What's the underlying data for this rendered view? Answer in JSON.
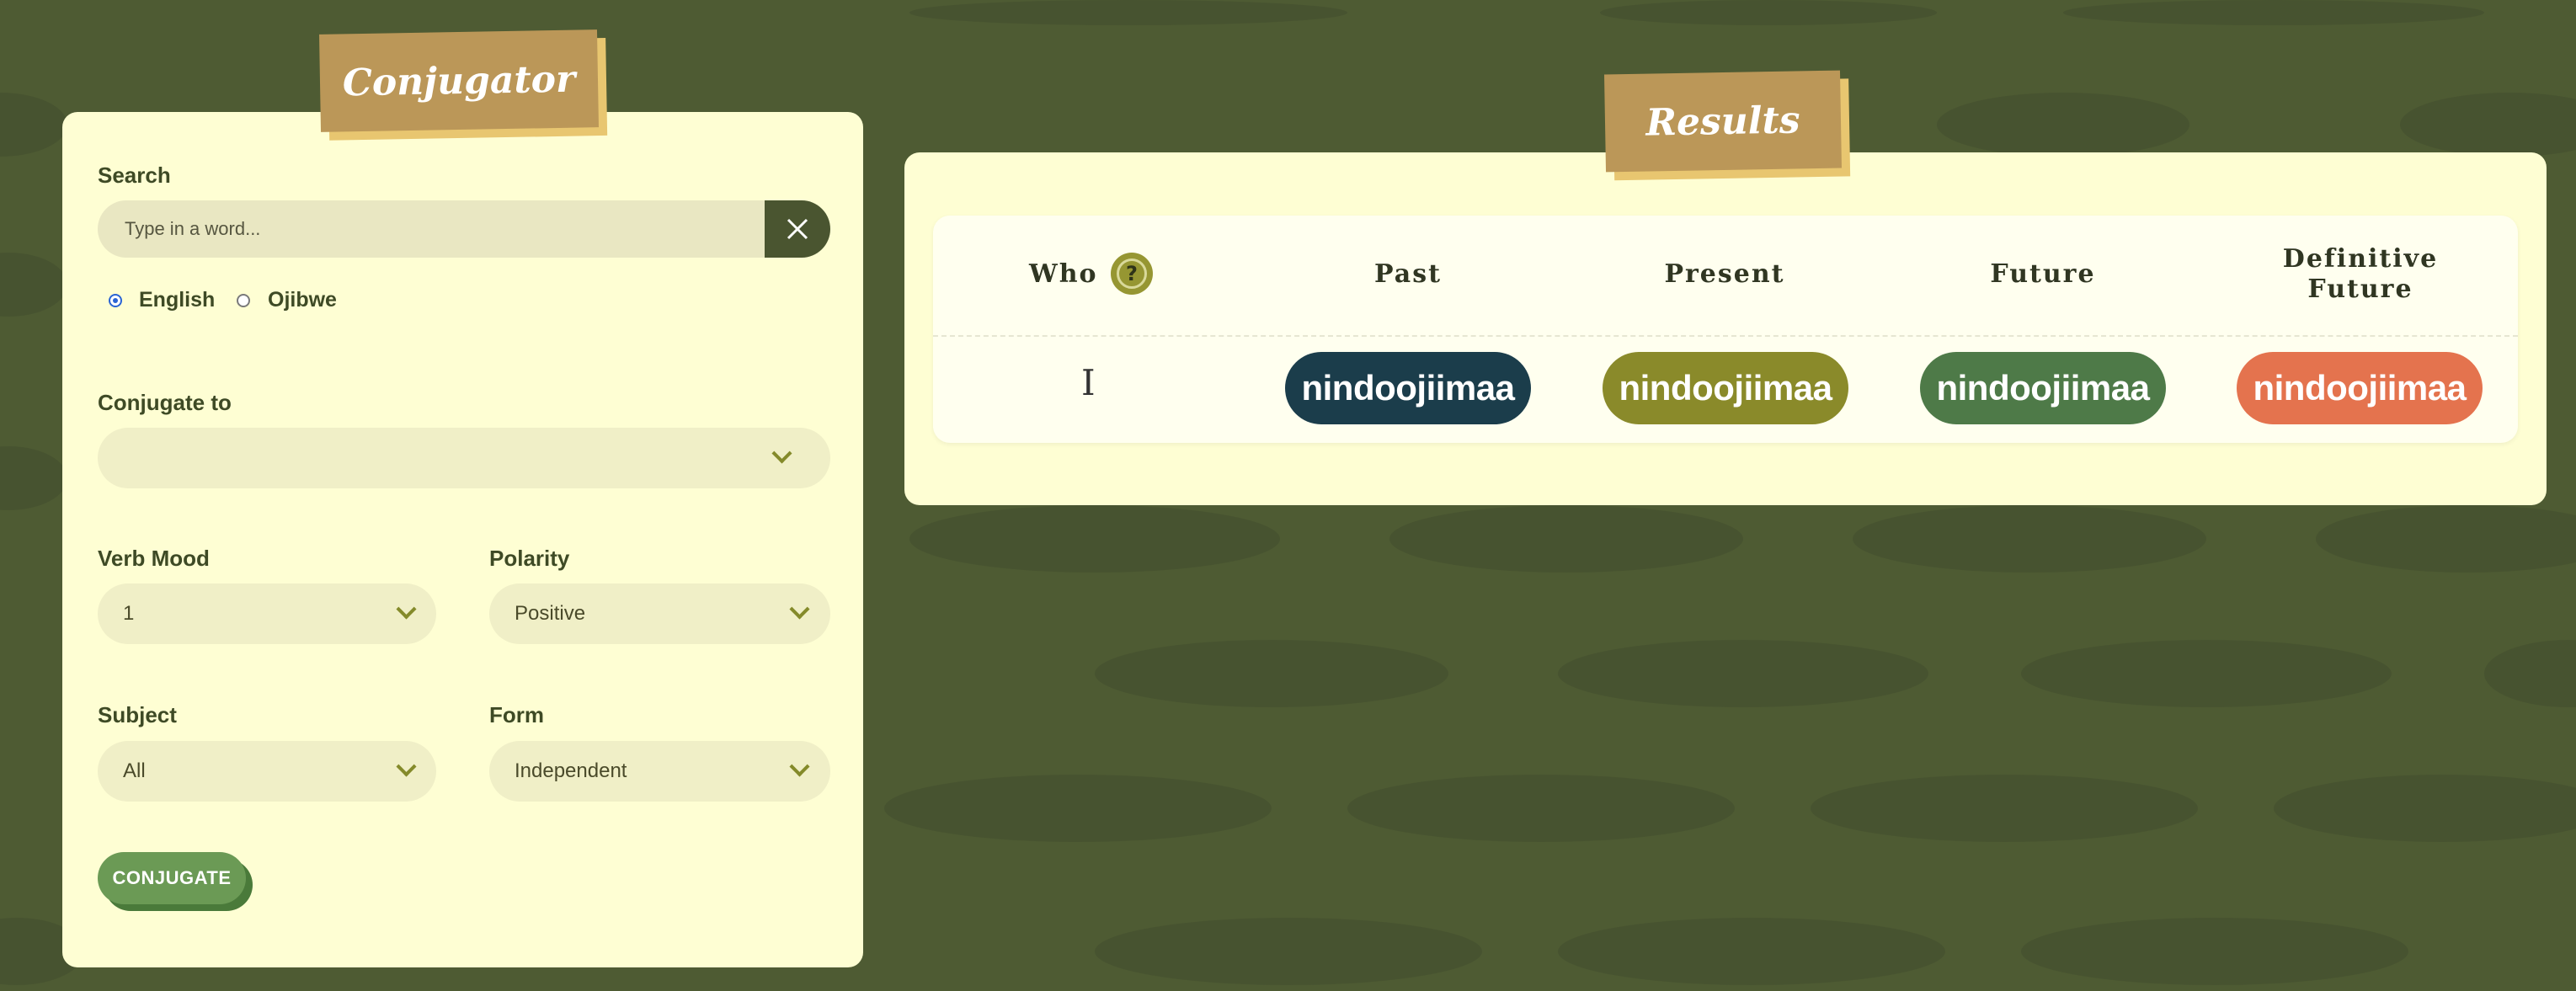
{
  "conjugator": {
    "title": "Conjugator",
    "search": {
      "label": "Search",
      "placeholder": "Type in a word...",
      "value": ""
    },
    "language": {
      "options": [
        {
          "label": "English",
          "selected": true
        },
        {
          "label": "Ojibwe",
          "selected": false
        }
      ]
    },
    "conjugate_to": {
      "label": "Conjugate to",
      "value": ""
    },
    "verb_mood": {
      "label": "Verb Mood",
      "value": "1"
    },
    "polarity": {
      "label": "Polarity",
      "value": "Positive"
    },
    "subject": {
      "label": "Subject",
      "value": "All"
    },
    "form": {
      "label": "Form",
      "value": "Independent"
    },
    "conjugate_button": "CONJUGATE"
  },
  "results": {
    "title": "Results",
    "columns": [
      "Who",
      "Past",
      "Present",
      "Future",
      "Definitive Future"
    ],
    "row": {
      "who": "I",
      "past": "nindoojiimaa",
      "present": "nindoojiimaa",
      "future": "nindoojiimaa",
      "definitive_future": "nindoojiimaa"
    },
    "colors": {
      "past": "#1b3d4b",
      "present": "#8a8a2a",
      "future": "#4e7a48",
      "definitive_future": "#e4734e"
    }
  },
  "icons": {
    "clear": "close-icon",
    "help": "help-icon",
    "dropdown": "chevron-down-icon"
  }
}
